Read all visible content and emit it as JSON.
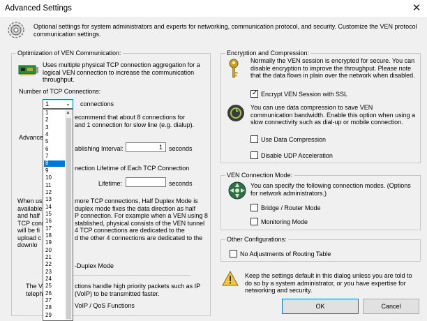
{
  "window": {
    "title": "Advanced Settings",
    "close_glyph": "✕"
  },
  "description": "Optional settings for system administrators and experts for networking, communication protocol, and security. Customize the VEN protocol communication settings.",
  "optimization": {
    "group_label": "Optimization of VEN Communication:",
    "intro": "Uses multiple physical TCP connection aggregation for a logical VEN connection to increase the communication throughput.",
    "tcp_label": "Number of TCP Connections:",
    "tcp_value": "1",
    "tcp_unit": "connections",
    "recommend_text": "ecommend that about 8 connections for\nand 1 connection for slow line (e.g. dialup).",
    "advanced_label": "Advance",
    "interval_label": "ablishing Interval:",
    "interval_value": "1",
    "interval_unit": "seconds",
    "lifetime_heading": "nection Lifetime of Each TCP Connection",
    "lifetime_label": "Lifetime:",
    "lifetime_value": "",
    "lifetime_unit": "seconds",
    "half_duplex_left": "When us\navailable\nand half\nTCP conn\nwill be fi\nupload c\ndownlo",
    "half_duplex_right": "more TCP connections, Half Duplex Mode is\nduplex mode fixes the data direction as half\nP connection. For example when a VEN using 8\nstablished, physical consists of the VEN tunnel\n4 TCP connections are dedicated to the\nd the other 4 connections are dedicated to the",
    "half_duplex_option": "-Duplex Mode",
    "voip_left": "The Vo\ntelepho",
    "voip_right": "ctions handle high priority packets such as IP\n(VoIP) to be transmitted faster.",
    "voip_option": "VoIP / QoS Functions"
  },
  "dropdown": {
    "options": [
      "1",
      "2",
      "3",
      "4",
      "5",
      "6",
      "7",
      "8",
      "9",
      "10",
      "11",
      "12",
      "13",
      "14",
      "15",
      "16",
      "17",
      "18",
      "19",
      "20",
      "21",
      "22",
      "23",
      "24",
      "25",
      "26",
      "27",
      "28",
      "29"
    ],
    "selected": "8"
  },
  "encryption": {
    "group_label": "Encryption and Compression:",
    "encrypt_text": "Normally the VEN session is encrypted for secure. You can disable encryption to improve the throughput. Please note that the data flows in plain over the network when disabled.",
    "encrypt_checkbox": "Encrypt VEN Session with SSL",
    "encrypt_checked": true,
    "compress_text": "You can use data compression to save VEN communication bandwidth. Enable this option when using a slow connectivity such as dial-up or mobile connection.",
    "compress_checkbox": "Use Data Compression",
    "compress_checked": false,
    "udp_checkbox": "Disable UDP Acceleration",
    "udp_checked": false
  },
  "mode": {
    "group_label": "VEN Connection Mode:",
    "text": "You can specify the following connection modes. (Options for network administrators.)",
    "bridge_checkbox": "Bridge / Router Mode",
    "monitor_checkbox": "Monitoring Mode"
  },
  "other": {
    "group_label": "Other Configurations:",
    "routing_checkbox": "No Adjustments of Routing Table"
  },
  "warning": "Keep the settings default in this dialog unless you are told to do so by a system administrator, or you have expertise for networking and security.",
  "buttons": {
    "ok": "OK",
    "cancel": "Cancel"
  }
}
